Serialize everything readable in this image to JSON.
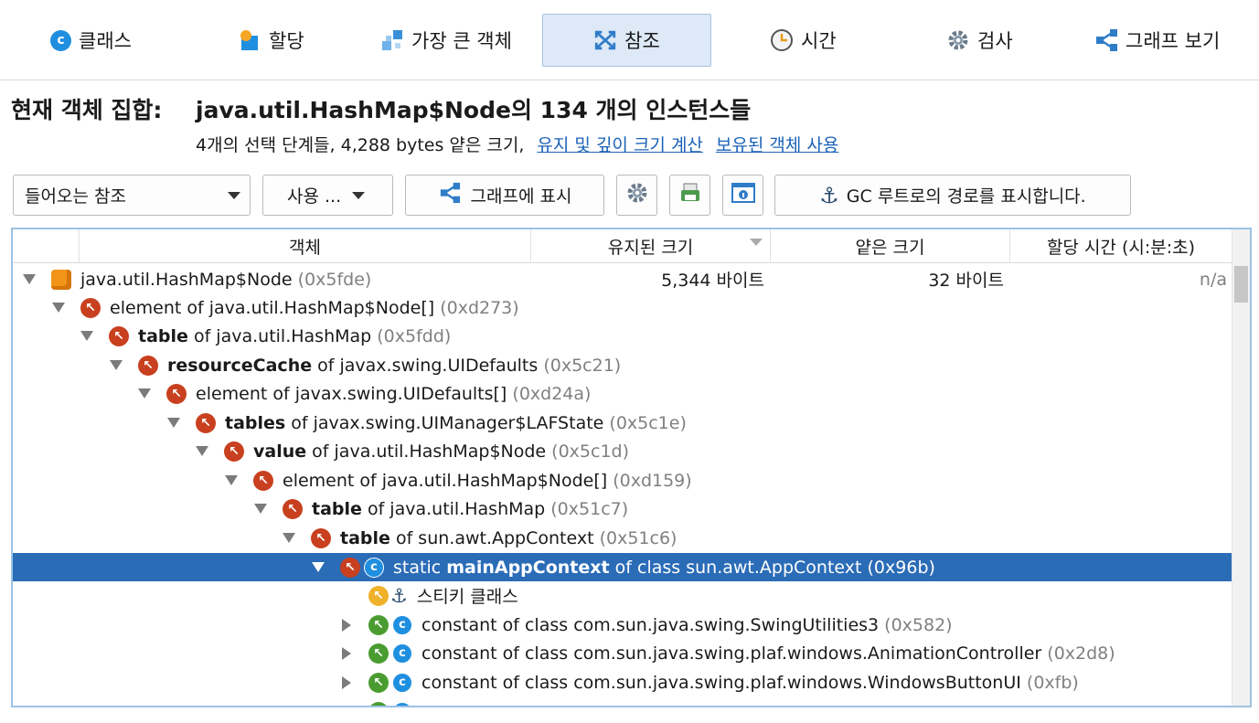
{
  "tabs": [
    {
      "label": "클래스",
      "icon": "class-icon"
    },
    {
      "label": "할당",
      "icon": "allocation-icon"
    },
    {
      "label": "가장 큰 객체",
      "icon": "biggest-objects-icon"
    },
    {
      "label": "참조",
      "icon": "references-icon",
      "active": true
    },
    {
      "label": "시간",
      "icon": "clock-icon"
    },
    {
      "label": "검사",
      "icon": "gear-icon"
    },
    {
      "label": "그래프 보기",
      "icon": "graph-icon"
    }
  ],
  "header": {
    "title_prefix": "현재 객체 집합:",
    "title_main": "java.util.HashMap$Node의 134 개의 인스턴스들",
    "subtitle": "4개의 선택 단계들, 4,288 bytes 얕은 크기,",
    "link_calc": "유지 및 깊이 크기 계산",
    "link_retained": "보유된 객체 사용"
  },
  "toolbar": {
    "combo_value": "들어오는 참조",
    "use_label": "사용 ...",
    "graph_label": "그래프에 표시",
    "gc_label": "GC 루트로의 경로를 표시합니다."
  },
  "columns": {
    "object": "객체",
    "retained": "유지된 크기",
    "shallow": "얕은 크기",
    "alloc_time": "할당 시간 (시:분:초)"
  },
  "rows": [
    {
      "pre": "",
      "bold": "",
      "post": "java.util.HashMap$Node",
      "addr": "(0x5fde)",
      "retained": "5,344 바이트",
      "shallow": "32 바이트",
      "time": "n/a"
    },
    {
      "pre": "element of java.util.HashMap$Node[]",
      "bold": "",
      "post": "",
      "addr": "(0xd273)"
    },
    {
      "pre": "",
      "bold": "table",
      "post": " of java.util.HashMap",
      "addr": "(0x5fdd)"
    },
    {
      "pre": "",
      "bold": "resourceCache",
      "post": " of javax.swing.UIDefaults",
      "addr": "(0x5c21)"
    },
    {
      "pre": "element of javax.swing.UIDefaults[]",
      "bold": "",
      "post": "",
      "addr": "(0xd24a)"
    },
    {
      "pre": "",
      "bold": "tables",
      "post": " of javax.swing.UIManager$LAFState",
      "addr": "(0x5c1e)"
    },
    {
      "pre": "",
      "bold": "value",
      "post": " of java.util.HashMap$Node",
      "addr": "(0x5c1d)"
    },
    {
      "pre": "element of java.util.HashMap$Node[]",
      "bold": "",
      "post": "",
      "addr": "(0xd159)"
    },
    {
      "pre": "",
      "bold": "table",
      "post": " of java.util.HashMap",
      "addr": "(0x51c7)"
    },
    {
      "pre": "",
      "bold": "table",
      "post": " of sun.awt.AppContext",
      "addr": "(0x51c6)"
    },
    {
      "pre": "static ",
      "bold": "mainAppContext",
      "post": " of class sun.awt.AppContext",
      "addr": "(0x96b)"
    },
    {
      "pre": "스티키 클래스",
      "bold": "",
      "post": "",
      "addr": ""
    },
    {
      "pre": "constant of class com.sun.java.swing.SwingUtilities3",
      "bold": "",
      "post": "",
      "addr": "(0x582)"
    },
    {
      "pre": "constant of class com.sun.java.swing.plaf.windows.AnimationController",
      "bold": "",
      "post": "",
      "addr": "(0x2d8)"
    },
    {
      "pre": "constant of class com.sun.java.swing.plaf.windows.WindowsButtonUI",
      "bold": "",
      "post": "",
      "addr": "(0xfb)"
    }
  ],
  "class_glyph": "c",
  "colors": {
    "selection": "#2b6cb7",
    "link": "#1a62b8",
    "ref_icon": "#c8401f",
    "class_icon": "#1f8fe0"
  }
}
